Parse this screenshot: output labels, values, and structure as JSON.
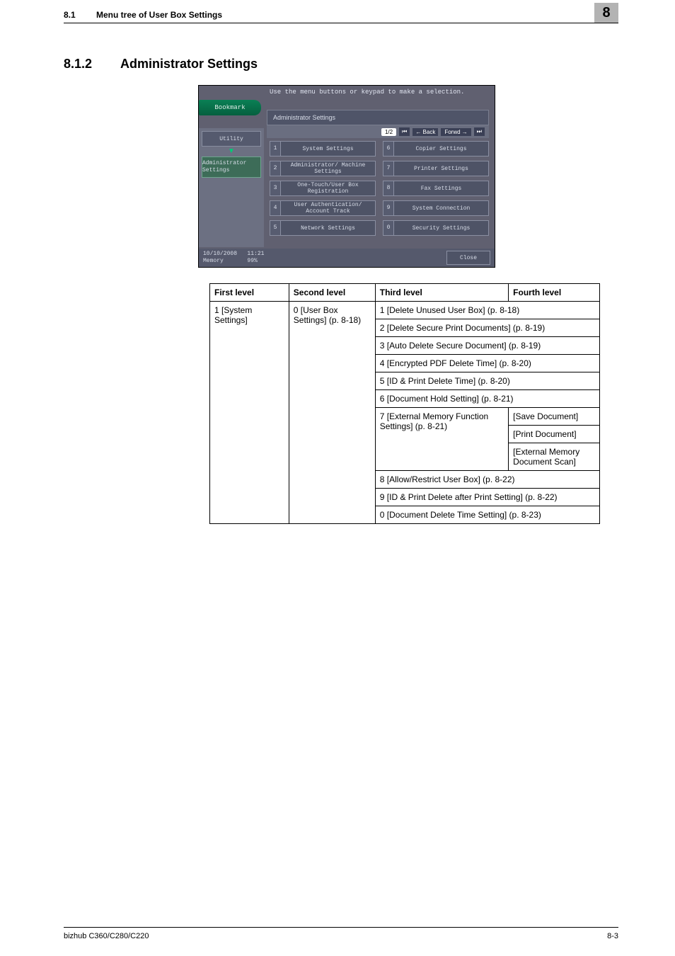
{
  "header": {
    "section_number": "8.1",
    "section_title": "Menu tree of User Box Settings",
    "chapter_number": "8"
  },
  "heading": {
    "number": "8.1.2",
    "title": "Administrator Settings"
  },
  "screenshot": {
    "instruction": "Use the menu buttons or keypad to make a selection.",
    "bookmark": "Bookmark",
    "panel_title": "Administrator Settings",
    "page_indicator": "1/2",
    "back_label": "Back",
    "left": {
      "utility": "Utility",
      "admin": "Administrator Settings"
    },
    "buttons": [
      {
        "n": "1",
        "t": "System Settings"
      },
      {
        "n": "6",
        "t": "Copier Settings"
      },
      {
        "n": "2",
        "t": "Administrator/ Machine Settings"
      },
      {
        "n": "7",
        "t": "Printer Settings"
      },
      {
        "n": "3",
        "t": "One-Touch/User Box Registration"
      },
      {
        "n": "8",
        "t": "Fax Settings"
      },
      {
        "n": "4",
        "t": "User Authentication/ Account Track"
      },
      {
        "n": "9",
        "t": "System Connection"
      },
      {
        "n": "5",
        "t": "Network Settings"
      },
      {
        "n": "0",
        "t": "Security Settings"
      }
    ],
    "status": {
      "date": "10/10/2008",
      "time": "11:21",
      "memory_label": "Memory",
      "memory_value": "99%",
      "close": "Close"
    }
  },
  "table": {
    "headers": [
      "First level",
      "Second level",
      "Third level",
      "Fourth level"
    ],
    "first_level": "1 [System Settings]",
    "second_level": "0 [User Box Settings] (p. 8-18)",
    "rows": [
      {
        "third_span": "1 [Delete Unused User Box] (p. 8-18)"
      },
      {
        "third_span": "2 [Delete Secure Print Documents] (p. 8-19)"
      },
      {
        "third_span": "3 [Auto Delete Secure Document] (p. 8-19)"
      },
      {
        "third_span": "4 [Encrypted PDF Delete Time] (p. 8-20)"
      },
      {
        "third_span": "5 [ID & Print Delete Time] (p. 8-20)"
      },
      {
        "third_span": "6 [Document Hold Setting] (p. 8-21)"
      },
      {
        "third": "7 [External Memory Function Settings] (p. 8-21)",
        "fourth": "[Save Document]"
      },
      {
        "fourth": "[Print Document]"
      },
      {
        "fourth": "[External Memory Document Scan]"
      },
      {
        "third_span": "8 [Allow/Restrict User Box] (p. 8-22)"
      },
      {
        "third_span": "9 [ID & Print Delete after Print Setting] (p. 8-22)"
      },
      {
        "third_span": "0 [Document Delete Time Setting] (p. 8-23)"
      }
    ]
  },
  "footer": {
    "left": "bizhub C360/C280/C220",
    "right": "8-3"
  }
}
